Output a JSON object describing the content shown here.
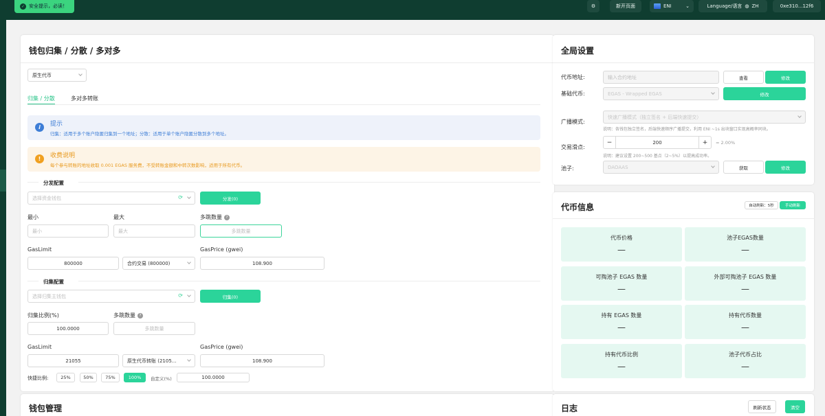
{
  "toast": {
    "text": "安全提示，必读！"
  },
  "topbar": {
    "new_page": "新开页面",
    "network": "ENI",
    "language_label": "Language/语言",
    "language_value": "ZH",
    "address": "0xe310...12f6"
  },
  "main": {
    "title": "钱包归集 / 分散 / 多对多",
    "token_type": "原生代币",
    "tabs": [
      "归集 / 分散",
      "多对多转账"
    ],
    "tip": {
      "title": "提示",
      "text": "归集：适用于多个账户隐匿归集到一个地址；分散：适用于单个账户隐匿分散到多个地址。"
    },
    "fee": {
      "title": "收费说明",
      "text": "每个参与转账的地址收取 0.001 EGAS 服务费，不受转账金额和中转次数影响，适用于所有代币。"
    },
    "distribute": {
      "section": "分发配置",
      "wallet_placeholder": "选择资金钱包",
      "button": "分发(0)",
      "min_label": "最小",
      "min_placeholder": "最小",
      "max_label": "最大",
      "max_placeholder": "最大",
      "hops_label": "多跳数量",
      "hops_placeholder": "多跳数量",
      "gaslimit_label": "GasLimit",
      "gaslimit_value": "800000",
      "gas_mode": "合约交易 (800000)",
      "gasprice_label": "GasPrice (gwei)",
      "gasprice_value": "108.900"
    },
    "collect": {
      "section": "归集配置",
      "wallet_placeholder": "选择归集主钱包",
      "button": "归集(0)",
      "ratio_label": "归集比例(%)",
      "ratio_value": "100.0000",
      "hops_label": "多跳数量",
      "hops_placeholder": "多跳数量",
      "gaslimit_label": "GasLimit",
      "gaslimit_value": "21055",
      "gas_mode": "原生代币转账 (2105...",
      "gasprice_label": "GasPrice (gwei)",
      "gasprice_value": "108.900"
    },
    "quick": {
      "label": "快捷比例:",
      "options": [
        "25%",
        "50%",
        "75%",
        "100%"
      ],
      "custom_label": "自定义(%)",
      "custom_value": "100.0000"
    }
  },
  "wallet": {
    "title": "钱包管理"
  },
  "global": {
    "title": "全局设置",
    "token_address_label": "代币地址:",
    "token_address_placeholder": "输入合约地址",
    "view_button": "查看",
    "modify_button": "修改",
    "base_token_label": "基础代币:",
    "base_token_value": "EGAS - Wrapped EGAS",
    "base_modify_button": "修改",
    "broadcast_label": "广播模式:",
    "broadcast_value": "快速广播模式（独立签名 + 后端快速提交）",
    "broadcast_note": "说明：各钱包独立签名，后端快速顺序广播提交，利用 ENI ~1s 出块窗口实现高概率同块。",
    "slippage_label": "交易滑点:",
    "slippage_minus": "−",
    "slippage_value": "200",
    "slippage_plus": "+",
    "slippage_pct": "= 2.00%",
    "slippage_note": "说明：建议设置 200~500 基点（2~5%）以提高成功率。",
    "pool_label": "池子:",
    "pool_value": "DAOAAS",
    "fetch_button": "获取",
    "pool_modify_button": "修改"
  },
  "token_info": {
    "title": "代币信息",
    "auto_refresh": "自动刷新：5秒",
    "manual_refresh": "手动刷新",
    "stats": [
      {
        "label": "代币价格",
        "value": "—"
      },
      {
        "label": "池子EGAS数量",
        "value": "—"
      },
      {
        "label": "可掏池子 EGAS 数量",
        "value": "—"
      },
      {
        "label": "外部可掏池子 EGAS 数量",
        "value": "—"
      },
      {
        "label": "持有 EGAS 数量",
        "value": "—"
      },
      {
        "label": "持有代币数量",
        "value": "—"
      },
      {
        "label": "持有代币比例",
        "value": "—"
      },
      {
        "label": "池子代币占比",
        "value": "—"
      }
    ]
  },
  "log": {
    "title": "日志",
    "refresh_button": "刷新状态",
    "clear_button": "清空"
  }
}
